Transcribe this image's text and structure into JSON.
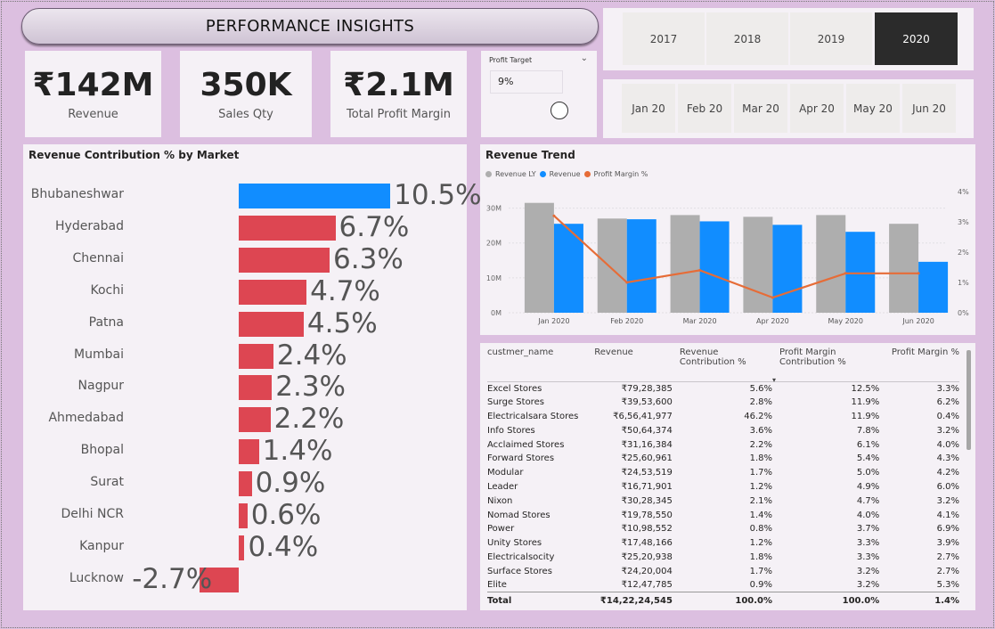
{
  "header": {
    "title": "PERFORMANCE INSIGHTS"
  },
  "kpis": [
    {
      "value": "₹142M",
      "label": "Revenue"
    },
    {
      "value": "350K",
      "label": "Sales Qty"
    },
    {
      "value": "₹2.1M",
      "label": "Total Profit Margin"
    }
  ],
  "profit_target": {
    "title": "Profit Target",
    "value": "9%"
  },
  "years": {
    "items": [
      "2017",
      "2018",
      "2019",
      "2020"
    ],
    "selected": "2020"
  },
  "months": {
    "items": [
      "Jan 20",
      "Feb 20",
      "Mar 20",
      "Apr 20",
      "May 20",
      "Jun 20"
    ]
  },
  "market_chart": {
    "title": "Revenue Contribution % by Market",
    "highlight_color": "#118dff",
    "bar_color": "#dd4652"
  },
  "trend_chart": {
    "title": "Revenue Trend",
    "legend": [
      "Revenue LY",
      "Revenue",
      "Profit Margin %"
    ],
    "colors": {
      "revenue_ly": "#aeaeae",
      "revenue": "#118dff",
      "margin": "#e66c37"
    }
  },
  "chart_data": [
    {
      "type": "bar",
      "orientation": "horizontal",
      "title": "Revenue Contribution % by Market",
      "categories": [
        "Bhubaneshwar",
        "Hyderabad",
        "Chennai",
        "Kochi",
        "Patna",
        "Mumbai",
        "Nagpur",
        "Ahmedabad",
        "Bhopal",
        "Surat",
        "Delhi NCR",
        "Kanpur",
        "Lucknow"
      ],
      "values": [
        10.5,
        6.7,
        6.3,
        4.7,
        4.5,
        2.4,
        2.3,
        2.2,
        1.4,
        0.9,
        0.6,
        0.4,
        -2.7
      ],
      "labels": [
        "10.5%",
        "6.7%",
        "6.3%",
        "4.7%",
        "4.5%",
        "2.4%",
        "2.3%",
        "2.2%",
        "1.4%",
        "0.9%",
        "0.6%",
        "0.4%",
        "-2.7%"
      ]
    },
    {
      "type": "bar",
      "title": "Revenue Trend",
      "categories": [
        "Jan 2020",
        "Feb 2020",
        "Mar 2020",
        "Apr 2020",
        "May 2020",
        "Jun 2020"
      ],
      "series": [
        {
          "name": "Revenue LY",
          "values": [
            31.5,
            27,
            28,
            27.5,
            28,
            25.5
          ]
        },
        {
          "name": "Revenue",
          "values": [
            25.5,
            26.8,
            26.2,
            25.2,
            23.2,
            14.6
          ]
        },
        {
          "name": "Profit Margin %",
          "type": "line",
          "axis": "right",
          "values": [
            3.2,
            1.0,
            1.4,
            0.5,
            1.3,
            1.3
          ]
        }
      ],
      "ylim": [
        0,
        35
      ],
      "yticks": [
        "0M",
        "10M",
        "20M",
        "30M"
      ],
      "y2lim": [
        0,
        4
      ],
      "y2ticks": [
        "0%",
        "1%",
        "2%",
        "3%",
        "4%"
      ],
      "legend_position": "top-left"
    }
  ],
  "table": {
    "columns": [
      "custmer_name",
      "Revenue",
      "Revenue Contribution %",
      "Profit Margin Contribution %",
      "Profit Margin %"
    ],
    "rows": [
      [
        "Excel Stores",
        "₹79,28,385",
        "5.6%",
        "12.5%",
        "3.3%"
      ],
      [
        "Surge Stores",
        "₹39,53,600",
        "2.8%",
        "11.9%",
        "6.2%"
      ],
      [
        "Electricalsara Stores",
        "₹6,56,41,977",
        "46.2%",
        "11.9%",
        "0.4%"
      ],
      [
        "Info Stores",
        "₹50,64,374",
        "3.6%",
        "7.8%",
        "3.2%"
      ],
      [
        "Acclaimed Stores",
        "₹31,16,384",
        "2.2%",
        "6.1%",
        "4.0%"
      ],
      [
        "Forward Stores",
        "₹25,60,961",
        "1.8%",
        "5.4%",
        "4.3%"
      ],
      [
        "Modular",
        "₹24,53,519",
        "1.7%",
        "5.0%",
        "4.2%"
      ],
      [
        "Leader",
        "₹16,71,901",
        "1.2%",
        "4.9%",
        "6.0%"
      ],
      [
        "Nixon",
        "₹30,28,345",
        "2.1%",
        "4.7%",
        "3.2%"
      ],
      [
        "Nomad Stores",
        "₹19,78,550",
        "1.4%",
        "4.0%",
        "4.1%"
      ],
      [
        "Power",
        "₹10,98,552",
        "0.8%",
        "3.7%",
        "6.9%"
      ],
      [
        "Unity Stores",
        "₹17,48,166",
        "1.2%",
        "3.3%",
        "3.9%"
      ],
      [
        "Electricalsocity",
        "₹25,20,938",
        "1.8%",
        "3.3%",
        "2.7%"
      ],
      [
        "Surface Stores",
        "₹24,20,004",
        "1.7%",
        "3.2%",
        "2.7%"
      ],
      [
        "Elite",
        "₹12,47,785",
        "0.9%",
        "3.2%",
        "5.3%"
      ]
    ],
    "total": [
      "Total",
      "₹14,22,24,545",
      "100.0%",
      "100.0%",
      "1.4%"
    ]
  }
}
